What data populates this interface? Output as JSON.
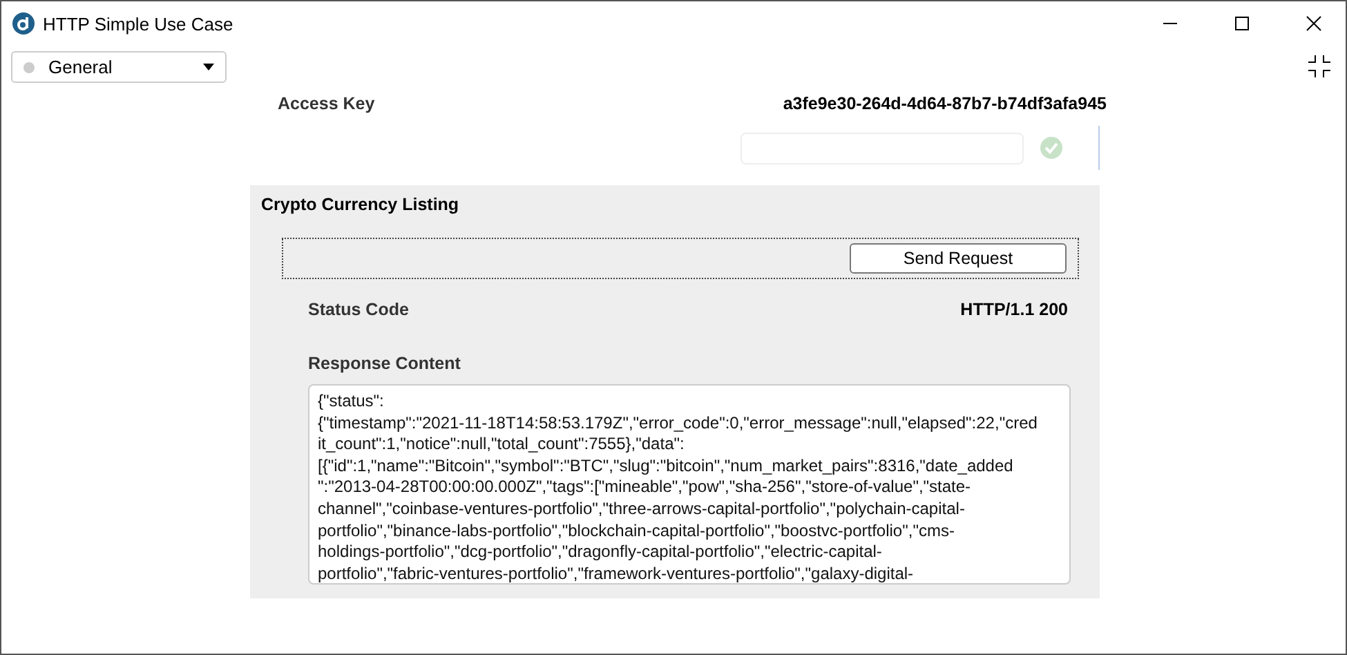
{
  "window": {
    "title": "HTTP Simple Use Case"
  },
  "profile_dropdown": {
    "value": "General"
  },
  "access_key": {
    "label": "Access Key",
    "value": "a3fe9e30-264d-4d64-87b7-b74df3afa945",
    "valid": true
  },
  "panel": {
    "title": "Crypto Currency Listing",
    "button": "Send Request",
    "status": {
      "label": "Status Code",
      "value": "HTTP/1.1 200"
    },
    "response": {
      "label": "Response Content",
      "lines": [
        "{\"status\":",
        "{\"timestamp\":\"2021-11-18T14:58:53.179Z\",\"error_code\":0,\"error_message\":null,\"elapsed\":22,\"cred",
        "it_count\":1,\"notice\":null,\"total_count\":7555},\"data\":",
        "[{\"id\":1,\"name\":\"Bitcoin\",\"symbol\":\"BTC\",\"slug\":\"bitcoin\",\"num_market_pairs\":8316,\"date_added",
        "\":\"2013-04-28T00:00:00.000Z\",\"tags\":[\"mineable\",\"pow\",\"sha-256\",\"store-of-value\",\"state-",
        "channel\",\"coinbase-ventures-portfolio\",\"three-arrows-capital-portfolio\",\"polychain-capital-",
        "portfolio\",\"binance-labs-portfolio\",\"blockchain-capital-portfolio\",\"boostvc-portfolio\",\"cms-",
        "holdings-portfolio\",\"dcg-portfolio\",\"dragonfly-capital-portfolio\",\"electric-capital-",
        "portfolio\",\"fabric-ventures-portfolio\",\"framework-ventures-portfolio\",\"galaxy-digital-"
      ]
    }
  }
}
